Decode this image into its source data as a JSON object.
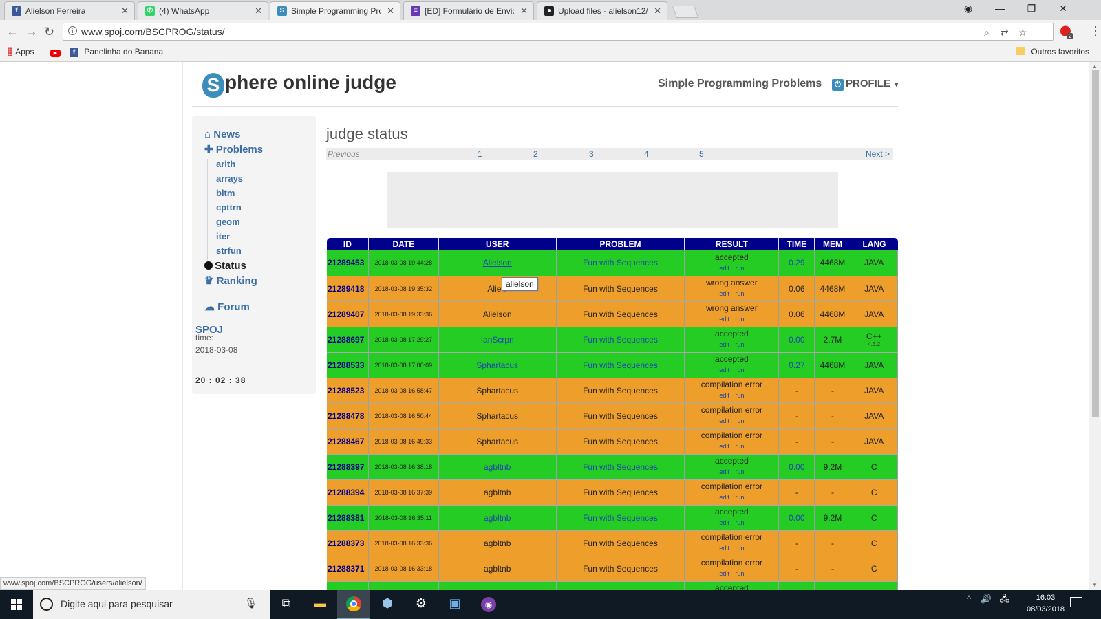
{
  "browser": {
    "tabs": [
      {
        "title": "Alielson Ferreira",
        "icon": "facebook-icon",
        "color": "#3b5998",
        "glyph": "f"
      },
      {
        "title": "(4) WhatsApp",
        "icon": "whatsapp-icon",
        "color": "#2fd566",
        "glyph": "✆"
      },
      {
        "title": "Simple Programming Pro",
        "icon": "spoj-icon",
        "color": "#3c8dbc",
        "glyph": "S"
      },
      {
        "title": "[ED] Formulário de Envio",
        "icon": "forms-icon",
        "color": "#673ab7",
        "glyph": "≡"
      },
      {
        "title": "Upload files · alielson12/",
        "icon": "github-icon",
        "color": "#222222",
        "glyph": "●"
      }
    ],
    "url": "www.spoj.com/BSCPROG/status/",
    "bookmarks": {
      "apps": "Apps",
      "panelinha": "Panelinha do Banana",
      "outros": "Outros favoritos"
    },
    "extension_badge": "2",
    "status_link": "www.spoj.com/BSCPROG/users/alielson/"
  },
  "site": {
    "logo_letter": "S",
    "logo_rest": "phere online judge",
    "header_link": "Simple Programming Problems",
    "profile_label": "PROFILE",
    "brand_color": "#3c8dbc"
  },
  "sidebar": {
    "news": "News",
    "problems": "Problems",
    "sub_items": [
      "arith",
      "arrays",
      "bitm",
      "cpttrn",
      "geom",
      "iter",
      "strfun"
    ],
    "status": "Status",
    "ranking": "Ranking",
    "forum": "Forum",
    "spoj": "SPOJ",
    "time_label": "time:",
    "date": "2018-03-08",
    "clock": "20 : 02 : 38"
  },
  "main": {
    "title": "judge status",
    "pager": {
      "prev": "Previous",
      "pages": [
        "1",
        "2",
        "3",
        "4",
        "5"
      ],
      "next": "Next >"
    },
    "columns": [
      "ID",
      "DATE",
      "USER",
      "PROBLEM",
      "RESULT",
      "TIME",
      "MEM",
      "LANG"
    ],
    "result_links": "edit run",
    "tooltip": "alielson",
    "rows": [
      {
        "id": "21289453",
        "date": "2018-03-08 19:44:28",
        "user": "Alielson",
        "problem": "Fun with Sequences",
        "result": "accepted",
        "time": "0.29",
        "mem": "4468M",
        "lang": "JAVA",
        "status": "ok"
      },
      {
        "id": "21289418",
        "date": "2018-03-08 19:35:32",
        "user": "Aliels",
        "problem": "Fun with Sequences",
        "result": "wrong answer",
        "time": "0.06",
        "mem": "4468M",
        "lang": "JAVA",
        "status": "bad"
      },
      {
        "id": "21289407",
        "date": "2018-03-08 19:33:36",
        "user": "Alielson",
        "problem": "Fun with Sequences",
        "result": "wrong answer",
        "time": "0.06",
        "mem": "4468M",
        "lang": "JAVA",
        "status": "bad"
      },
      {
        "id": "21288697",
        "date": "2018-03-08 17:29:27",
        "user": "IanScrpn",
        "problem": "Fun with Sequences",
        "result": "accepted",
        "time": "0.00",
        "mem": "2.7M",
        "lang": "C++",
        "langver": "4.3.2",
        "status": "ok"
      },
      {
        "id": "21288533",
        "date": "2018-03-08 17:00:09",
        "user": "Sphartacus",
        "problem": "Fun with Sequences",
        "result": "accepted",
        "time": "0.27",
        "mem": "4468M",
        "lang": "JAVA",
        "status": "ok"
      },
      {
        "id": "21288523",
        "date": "2018-03-08 16:58:47",
        "user": "Sphartacus",
        "problem": "Fun with Sequences",
        "result": "compilation error",
        "time": "-",
        "mem": "-",
        "lang": "JAVA",
        "status": "bad"
      },
      {
        "id": "21288478",
        "date": "2018-03-08 16:50:44",
        "user": "Sphartacus",
        "problem": "Fun with Sequences",
        "result": "compilation error",
        "time": "-",
        "mem": "-",
        "lang": "JAVA",
        "status": "bad"
      },
      {
        "id": "21288467",
        "date": "2018-03-08 16:49:33",
        "user": "Sphartacus",
        "problem": "Fun with Sequences",
        "result": "compilation error",
        "time": "-",
        "mem": "-",
        "lang": "JAVA",
        "status": "bad"
      },
      {
        "id": "21288397",
        "date": "2018-03-08 16:38:18",
        "user": "agbltnb",
        "problem": "Fun with Sequences",
        "result": "accepted",
        "time": "0.00",
        "mem": "9.2M",
        "lang": "C",
        "status": "ok"
      },
      {
        "id": "21288394",
        "date": "2018-03-08 16:37:39",
        "user": "agbltnb",
        "problem": "Fun with Sequences",
        "result": "compilation error",
        "time": "-",
        "mem": "-",
        "lang": "C",
        "status": "bad"
      },
      {
        "id": "21288381",
        "date": "2018-03-08 16:35:11",
        "user": "agbltnb",
        "problem": "Fun with Sequences",
        "result": "accepted",
        "time": "0.00",
        "mem": "9.2M",
        "lang": "C",
        "status": "ok"
      },
      {
        "id": "21288373",
        "date": "2018-03-08 16:33:36",
        "user": "agbltnb",
        "problem": "Fun with Sequences",
        "result": "compilation error",
        "time": "-",
        "mem": "-",
        "lang": "C",
        "status": "bad"
      },
      {
        "id": "21288371",
        "date": "2018-03-08 16:33:18",
        "user": "agbltnb",
        "problem": "Fun with Sequences",
        "result": "compilation error",
        "time": "-",
        "mem": "-",
        "lang": "C",
        "status": "bad"
      },
      {
        "id": "",
        "date": "",
        "user": "",
        "problem": "",
        "result": "accepted",
        "time": "",
        "mem": "",
        "lang": "",
        "status": "ok"
      }
    ],
    "accepted_color": "#24cc24",
    "rejected_color": "#ee9e2a",
    "header_color": "#00008b"
  },
  "taskbar": {
    "search_placeholder": "Digite aqui para pesquisar",
    "time": "16:03",
    "date": "08/03/2018"
  }
}
